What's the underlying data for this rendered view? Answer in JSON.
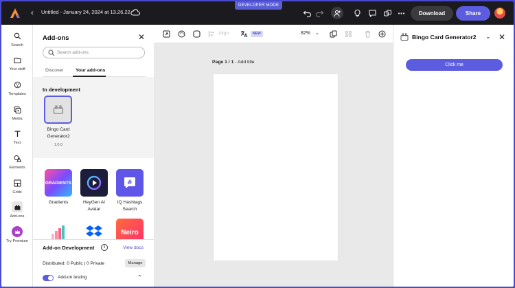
{
  "topbar": {
    "document_title": "Untitled - January 24, 2024 at 13.26.22",
    "developer_mode_badge": "DEVELOPER MODE",
    "download_label": "Download",
    "share_label": "Share"
  },
  "rail": {
    "items": [
      {
        "label": "Search",
        "icon": "search-icon"
      },
      {
        "label": "Your stuff",
        "icon": "folder-icon"
      },
      {
        "label": "Templates",
        "icon": "templates-icon"
      },
      {
        "label": "Media",
        "icon": "media-icon"
      },
      {
        "label": "Text",
        "icon": "text-icon"
      },
      {
        "label": "Elements",
        "icon": "elements-icon"
      },
      {
        "label": "Grids",
        "icon": "grids-icon"
      },
      {
        "label": "Add-ons",
        "icon": "addons-icon",
        "active": true
      },
      {
        "label": "Try Premium",
        "icon": "crown-icon"
      }
    ]
  },
  "addons_panel": {
    "title": "Add-ons",
    "search_placeholder": "Search add-ons",
    "tabs": [
      {
        "label": "Discover",
        "active": false
      },
      {
        "label": "Your add-ons",
        "active": true
      }
    ],
    "in_development": {
      "heading": "In development",
      "item": {
        "name": "Bingo Card Generator2",
        "version": "1.0.0"
      }
    },
    "addons": [
      {
        "name": "Gradients",
        "tile_text": "GRADIENTS"
      },
      {
        "name": "HeyGen AI Avatar"
      },
      {
        "name": "IQ Hashtags Search"
      },
      {
        "name": ""
      },
      {
        "name": ""
      },
      {
        "name": "",
        "tile_text": "Neiro"
      }
    ],
    "dev_footer": {
      "title": "Add-on Development",
      "view_docs": "View docs",
      "distributed_label": "Distributed:",
      "distributed_value": "0 Public | 0 Private",
      "manage_label": "Manage",
      "testing_label": "Add-on testing"
    }
  },
  "toolbar": {
    "align_label": "Align",
    "new_badge": "NEW",
    "zoom": "82%"
  },
  "canvas": {
    "page_label_bold": "Page 1 / 1",
    "page_label_rest": " - Add title"
  },
  "right_panel": {
    "title": "Bingo Card Generator2",
    "button_label": "Click me"
  },
  "colors": {
    "accent": "#5c5ce0",
    "topbar": "#1b1b1f",
    "frame": "#4a4ad0"
  }
}
